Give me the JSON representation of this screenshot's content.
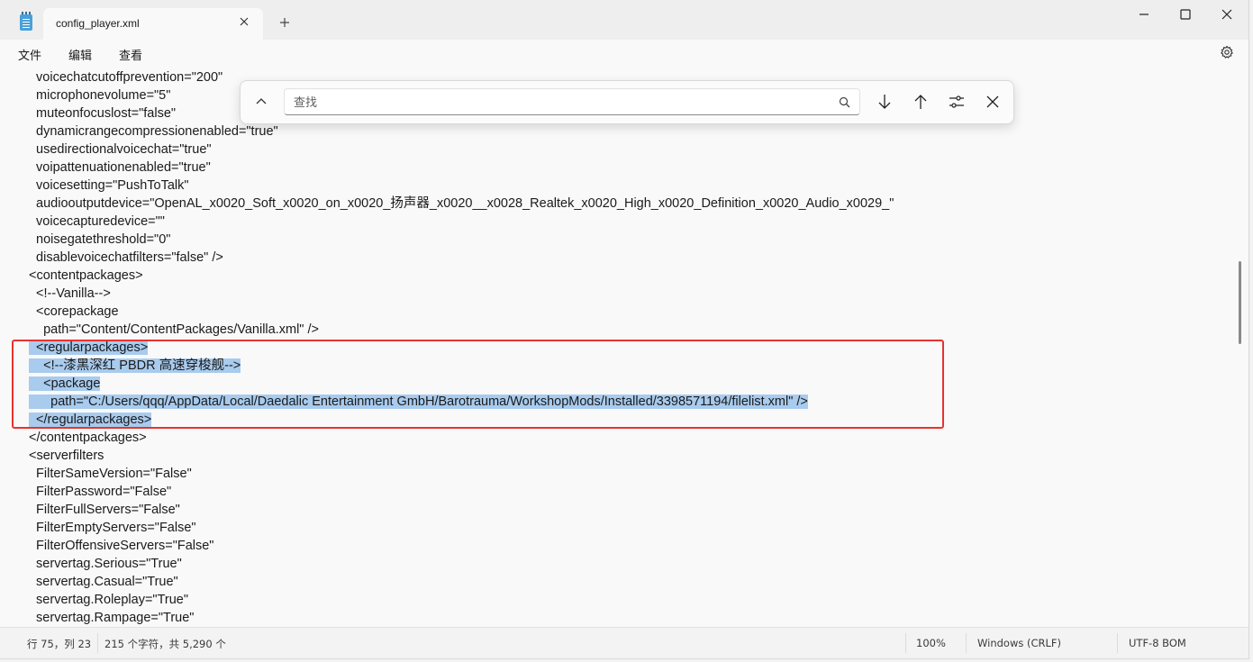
{
  "window": {
    "tab_title": "config_player.xml"
  },
  "menu": {
    "file": "文件",
    "edit": "编辑",
    "view": "查看"
  },
  "find": {
    "placeholder": "查找",
    "value": ""
  },
  "editor": {
    "lines": [
      "  voicechatcutoffprevention=\"200\"",
      "  microphonevolume=\"5\"",
      "  muteonfocuslost=\"false\"",
      "  dynamicrangecompressionenabled=\"true\"",
      "  usedirectionalvoicechat=\"true\"",
      "  voipattenuationenabled=\"true\"",
      "  voicesetting=\"PushToTalk\"",
      "  audiooutputdevice=\"OpenAL_x0020_Soft_x0020_on_x0020_扬声器_x0020__x0028_Realtek_x0020_High_x0020_Definition_x0020_Audio_x0029_\"",
      "  voicecapturedevice=\"\"",
      "  noisegatethreshold=\"0\"",
      "  disablevoicechatfilters=\"false\" />",
      "<contentpackages>",
      "  <!--Vanilla-->",
      "  <corepackage",
      "    path=\"Content/ContentPackages/Vanilla.xml\" />",
      "  <regularpackages>",
      "    <!--漆黑深红 PBDR 高速穿梭舰-->",
      "    <package",
      "      path=\"C:/Users/qqq/AppData/Local/Daedalic Entertainment GmbH/Barotrauma/WorkshopMods/Installed/3398571194/filelist.xml\" />",
      "  </regularpackages>",
      "</contentpackages>",
      "<serverfilters",
      "  FilterSameVersion=\"False\"",
      "  FilterPassword=\"False\"",
      "  FilterFullServers=\"False\"",
      "  FilterEmptyServers=\"False\"",
      "  FilterOffensiveServers=\"False\"",
      "  servertag.Serious=\"True\"",
      "  servertag.Casual=\"True\"",
      "  servertag.Roleplay=\"True\"",
      "  servertag.Rampage=\"True\""
    ],
    "selected_line_indices": [
      15,
      16,
      17,
      18,
      19
    ],
    "annotation_color": "#e8322f",
    "selection_color": "#a8cbee"
  },
  "status": {
    "position": "行 75，列 23",
    "char_count": "215 个字符，共 5,290 个",
    "zoom": "100%",
    "line_ending": "Windows (CRLF)",
    "encoding": "UTF-8 BOM"
  }
}
